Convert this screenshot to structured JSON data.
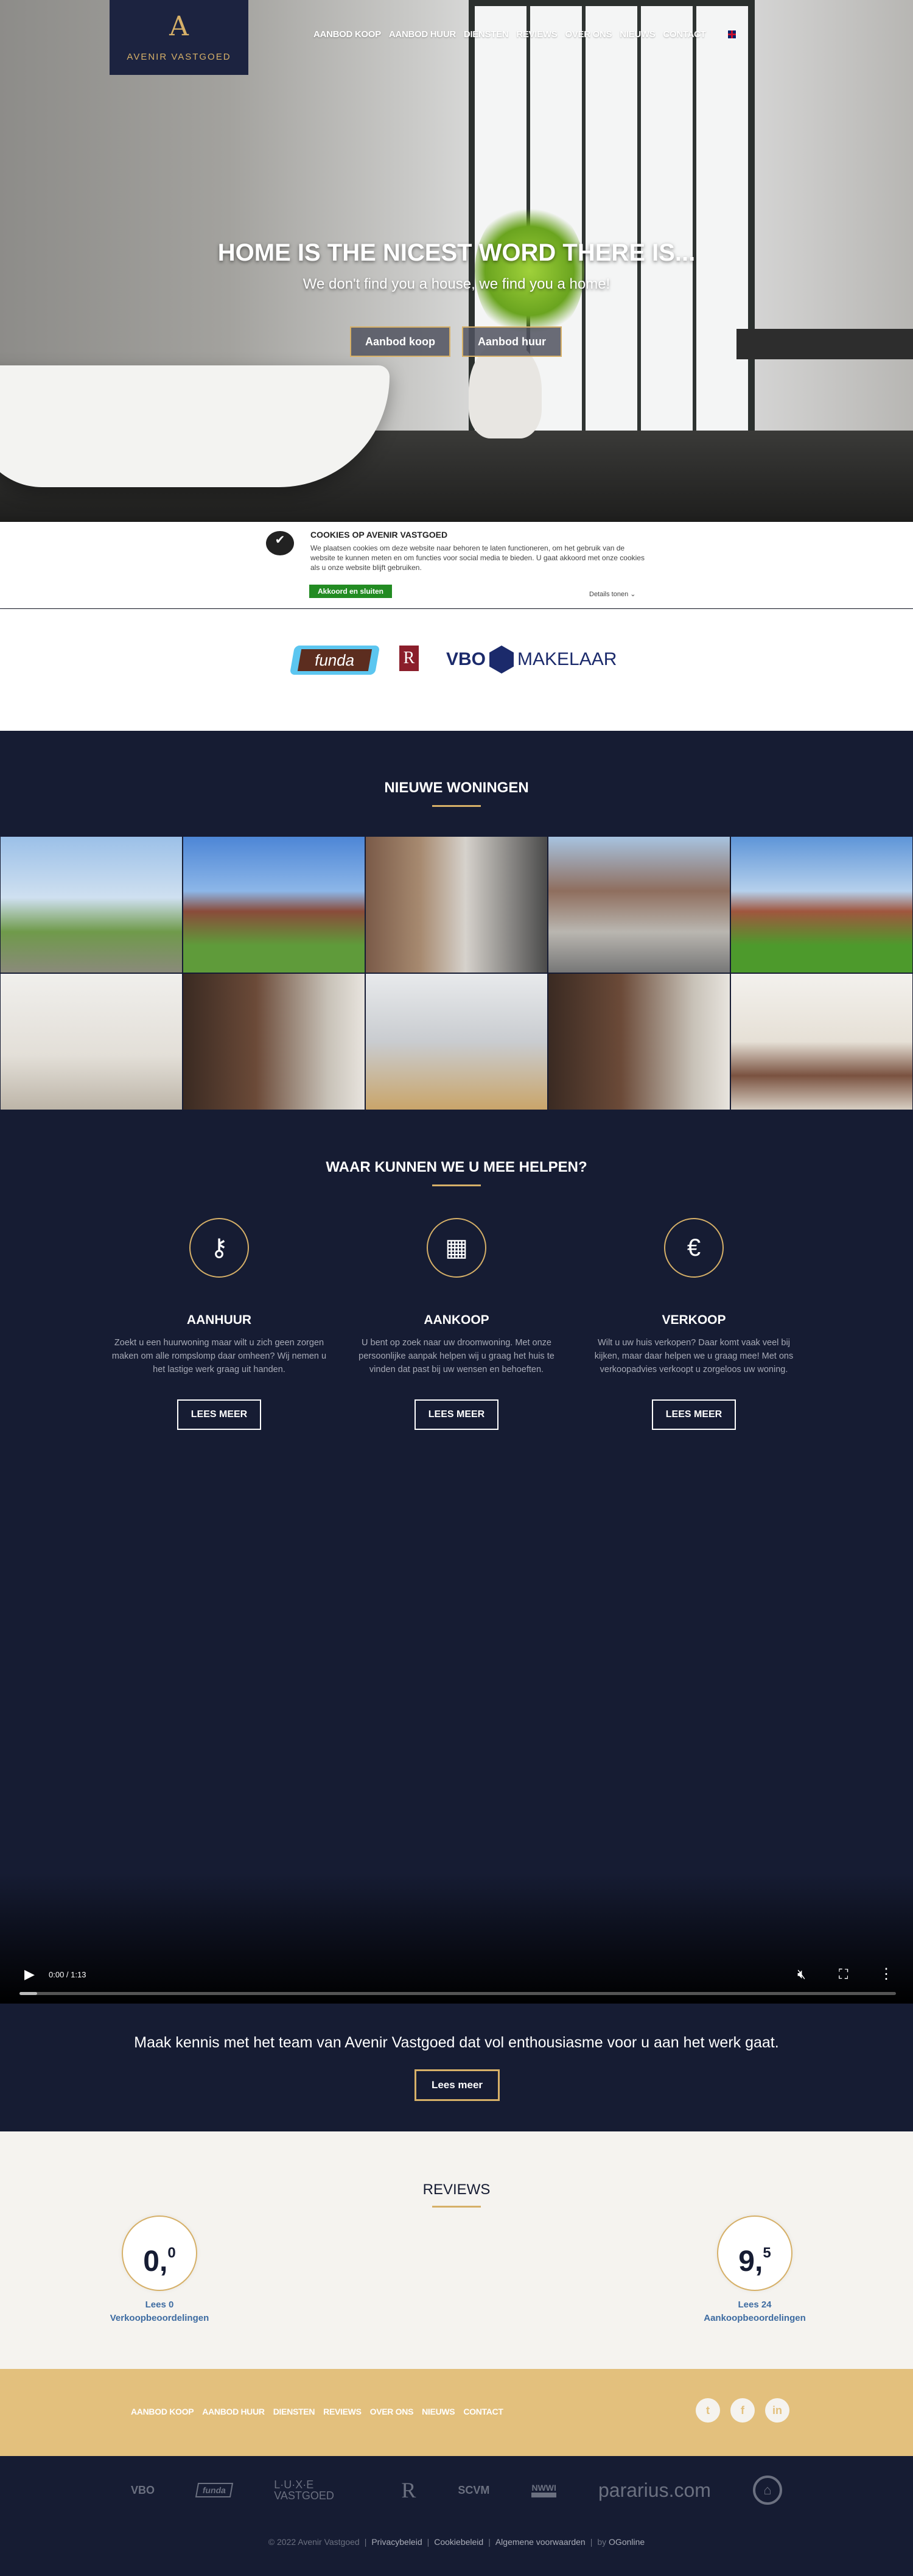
{
  "brand": {
    "name": "AVENIR VASTGOED",
    "monogram": "A"
  },
  "nav": {
    "items": [
      "AANBOD KOOP",
      "AANBOD HUUR",
      "DIENSTEN",
      "REVIEWS",
      "OVER ONS",
      "NIEUWS",
      "CONTACT"
    ],
    "language_icon": "uk-flag-icon"
  },
  "hero": {
    "title": "HOME IS THE NICEST WORD THERE IS...",
    "subtitle": "We don't find you a house, we find you a home!",
    "buttons": [
      "Aanbod koop",
      "Aanbod huur"
    ]
  },
  "cookie": {
    "title": "COOKIES OP AVENIR VASTGOED",
    "text": "We plaatsen cookies om deze website naar behoren te laten functioneren, om het gebruik van de website te kunnen meten en om functies voor social media te bieden. U gaat akkoord met onze cookies als u onze website blijft gebruiken.",
    "accept": "Akkoord en sluiten",
    "details": "Details tonen",
    "details_icon": "chevron-down-icon"
  },
  "partners": {
    "funda": "funda",
    "vbo": "VBO",
    "vbo_suffix": "MAKELAAR",
    "register": "R"
  },
  "new_homes": {
    "title": "NIEUWE WONINGEN",
    "photo_count": 10
  },
  "services": {
    "title": "WAAR KUNNEN WE U MEE HELPEN?",
    "items": [
      {
        "icon": "key-icon",
        "title": "AANHUUR",
        "text": "Zoekt u een huurwoning maar wilt u zich geen zorgen maken om alle rompslomp daar omheen? Wij nemen u het lastige werk graag uit handen.",
        "button": "LEES MEER"
      },
      {
        "icon": "buildings-icon",
        "title": "AANKOOP",
        "text": "U bent op zoek naar uw droomwoning. Met onze persoonlijke aanpak helpen wij u graag het huis te vinden dat past bij uw wensen en behoeften.",
        "button": "LEES MEER"
      },
      {
        "icon": "price-tag-icon",
        "title": "VERKOOP",
        "text": "Wilt u uw huis verkopen? Daar komt vaak veel bij kijken, maar daar helpen we u graag mee! Met ons verkoopadvies verkoopt u zorgeloos uw woning.",
        "button": "LEES MEER"
      }
    ]
  },
  "video": {
    "time": "0:00 / 1:13",
    "progress": 0.02,
    "muted": true
  },
  "team": {
    "text": "Maak kennis met het team van Avenir Vastgoed dat vol enthousiasme voor u aan het werk gaat.",
    "button": "Lees meer"
  },
  "reviews": {
    "title": "REVIEWS",
    "items": [
      {
        "score_int": "0,",
        "score_dec": "0",
        "line1": "Lees 0",
        "line2": "Verkoopbeoordelingen"
      },
      {
        "score_int": "9,",
        "score_dec": "5",
        "line1": "Lees 24",
        "line2": "Aankoopbeoordelingen"
      }
    ]
  },
  "footer": {
    "nav": [
      "AANBOD KOOP",
      "AANBOD HUUR",
      "DIENSTEN",
      "REVIEWS",
      "OVER ONS",
      "NIEUWS",
      "CONTACT"
    ],
    "social": [
      "twitter-icon",
      "facebook-icon",
      "linkedin-icon"
    ],
    "logos": [
      "VBO",
      "funda",
      "L·U·X·E VASTGOED",
      "R",
      "SCVM",
      "NWWI",
      "pararius.com",
      "home-icon"
    ],
    "copyright": "© 2022 Avenir Vastgoed",
    "links": [
      "Privacybeleid",
      "Cookiebeleid",
      "Algemene voorwaarden"
    ],
    "by": "by",
    "by_link": "OGonline"
  },
  "colors": {
    "navy": "#161c33",
    "gold": "#d6b068",
    "gold_footer": "#e3c07d",
    "cream": "#f5f3ef",
    "accept_green": "#228b22",
    "link_blue": "#3d6ba1"
  }
}
